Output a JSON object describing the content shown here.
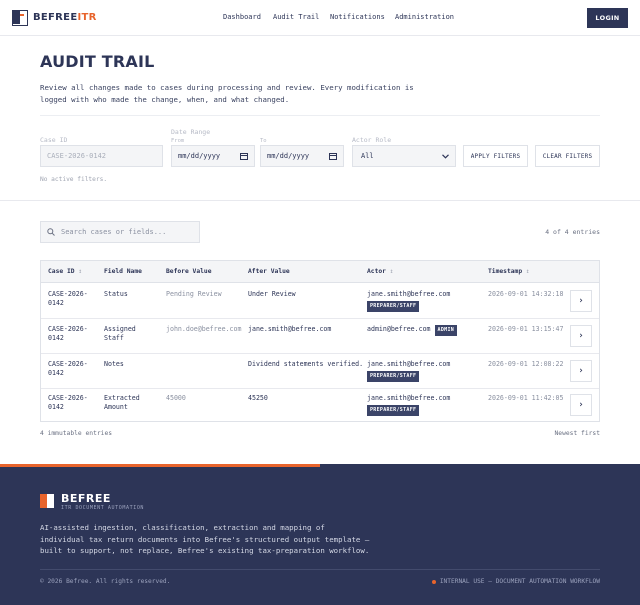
{
  "header": {
    "logo_main": "BEFREE",
    "logo_accent": "ITR",
    "nav": [
      "Dashboard",
      "Audit Trail",
      "Notifications",
      "Administration"
    ],
    "login_label": "LOGIN"
  },
  "page": {
    "title": "AUDIT TRAIL",
    "description": "Review all changes made to cases during processing and review. Every modification is logged with who made the change, when, and what changed."
  },
  "filters": {
    "case_id_label": "Case ID",
    "case_id_placeholder": "CASE-2026-0142",
    "date_range_label": "Date Range",
    "from_label": "From",
    "to_label": "To",
    "from_value": "mm/dd/yyyy",
    "to_value": "mm/dd/yyyy",
    "actor_role_label": "Actor Role",
    "actor_role_value": "All",
    "apply_label": "APPLY FILTERS",
    "clear_label": "CLEAR FILTERS",
    "status": "No active filters."
  },
  "search": {
    "placeholder": "Search cases or fields...",
    "count": "4 of 4 entries"
  },
  "table": {
    "headers": {
      "case_id": "Case ID",
      "field_name": "Field Name",
      "before_value": "Before Value",
      "after_value": "After Value",
      "actor": "Actor",
      "timestamp": "Timestamp"
    },
    "sort_glyph": "↕",
    "rows": [
      {
        "case_id_1": "CASE-2026-",
        "case_id_2": "0142",
        "field_1": "Status",
        "field_2": "",
        "before": "Pending Review",
        "after": "Under Review",
        "actor": "jane.smith@befree.com",
        "role": "PREPARER/STAFF",
        "timestamp": "2026-09-01 14:32:18"
      },
      {
        "case_id_1": "CASE-2026-",
        "case_id_2": "0142",
        "field_1": "Assigned",
        "field_2": "Staff",
        "before": "john.doe@befree.com",
        "after": "jane.smith@befree.com",
        "actor": "admin@befree.com",
        "role": "ADMIN",
        "timestamp": "2026-09-01 13:15:47"
      },
      {
        "case_id_1": "CASE-2026-",
        "case_id_2": "0142",
        "field_1": "Notes",
        "field_2": "",
        "before": "",
        "after": "Dividend statements verified.",
        "actor": "jane.smith@befree.com",
        "role": "PREPARER/STAFF",
        "timestamp": "2026-09-01 12:08:22"
      },
      {
        "case_id_1": "CASE-2026-",
        "case_id_2": "0142",
        "field_1": "Extracted",
        "field_2": "Amount",
        "before": "45000",
        "after": "45250",
        "actor": "jane.smith@befree.com",
        "role": "PREPARER/STAFF",
        "timestamp": "2026-09-01 11:42:05"
      }
    ],
    "row_button_glyph": "›"
  },
  "table_footer": {
    "immutable": "4 immutable entries",
    "order": "Newest first"
  },
  "footer": {
    "name": "BEFREE",
    "subtitle": "ITR DOCUMENT AUTOMATION",
    "description": "AI-assisted ingestion, classification, extraction and mapping of individual tax return documents into Befree's structured output template — built to support, not replace, Befree's existing tax-preparation workflow.",
    "copyright": "© 2026 Befree. All rights reserved.",
    "internal": "INTERNAL USE — DOCUMENT AUTOMATION WORKFLOW"
  },
  "colors": {
    "brand_navy": "#2d3557",
    "accent_orange": "#e8642c"
  },
  "icons": [
    "logo-icon",
    "calendar-icon",
    "chevron-down-icon",
    "search-icon",
    "chevron-right-icon"
  ]
}
